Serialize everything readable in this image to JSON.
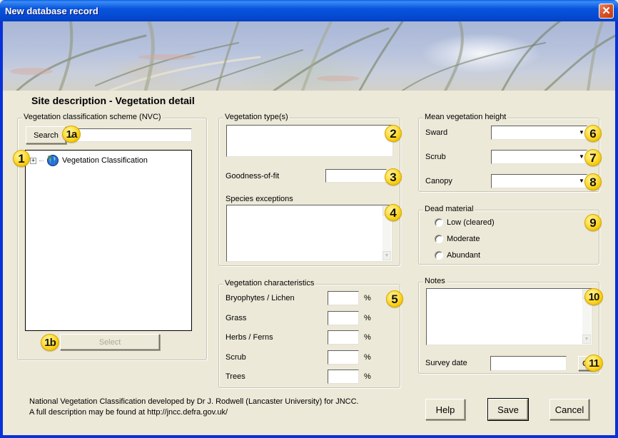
{
  "window": {
    "title": "New database record",
    "close_icon": "close-icon"
  },
  "page": {
    "section_title": "Site description - Vegetation detail"
  },
  "nvc": {
    "legend": "Vegetation classification scheme (NVC)",
    "search_label": "Search",
    "search_value": "",
    "tree_items": [
      {
        "label": "Vegetation Classification",
        "expander": "+",
        "icon": "globe-icon"
      }
    ],
    "select_label": "Select",
    "select_disabled": true
  },
  "vegetation_types": {
    "legend": "Vegetation type(s)",
    "value": "",
    "goodness_label": "Goodness-of-fit",
    "goodness_value": "",
    "species_label": "Species exceptions",
    "species_value": ""
  },
  "characteristics": {
    "legend": "Vegetation characteristics",
    "unit": "%",
    "rows": [
      {
        "label": "Bryophytes / Lichen",
        "value": ""
      },
      {
        "label": "Grass",
        "value": ""
      },
      {
        "label": "Herbs / Ferns",
        "value": ""
      },
      {
        "label": "Scrub",
        "value": ""
      },
      {
        "label": "Trees",
        "value": ""
      }
    ]
  },
  "height": {
    "legend": "Mean vegetation height",
    "rows": [
      {
        "label": "Sward",
        "value": ""
      },
      {
        "label": "Scrub",
        "value": ""
      },
      {
        "label": "Canopy",
        "value": ""
      }
    ]
  },
  "dead_material": {
    "legend": "Dead material",
    "options": [
      "Low (cleared)",
      "Moderate",
      "Abundant"
    ],
    "selected": null
  },
  "notes": {
    "legend": "Notes",
    "value": "",
    "survey_date_label": "Survey date",
    "survey_date_value": "",
    "calendar_button_label": "C"
  },
  "footer": {
    "line1": "National Vegetation Classification developed by Dr J. Rodwell (Lancaster University) for JNCC.",
    "line2": "A full description may be found at http://jncc.defra.gov.uk/"
  },
  "buttons": {
    "help": "Help",
    "save": "Save",
    "cancel": "Cancel"
  },
  "callouts": {
    "c1": "1",
    "c1a": "1a",
    "c1b": "1b",
    "c2": "2",
    "c3": "3",
    "c4": "4",
    "c5": "5",
    "c6": "6",
    "c7": "7",
    "c8": "8",
    "c9": "9",
    "c10": "10",
    "c11": "11"
  },
  "colors": {
    "title_bar": "#0855dd",
    "dialog_bg": "#ece9d8",
    "callout": "#ffe04a"
  }
}
